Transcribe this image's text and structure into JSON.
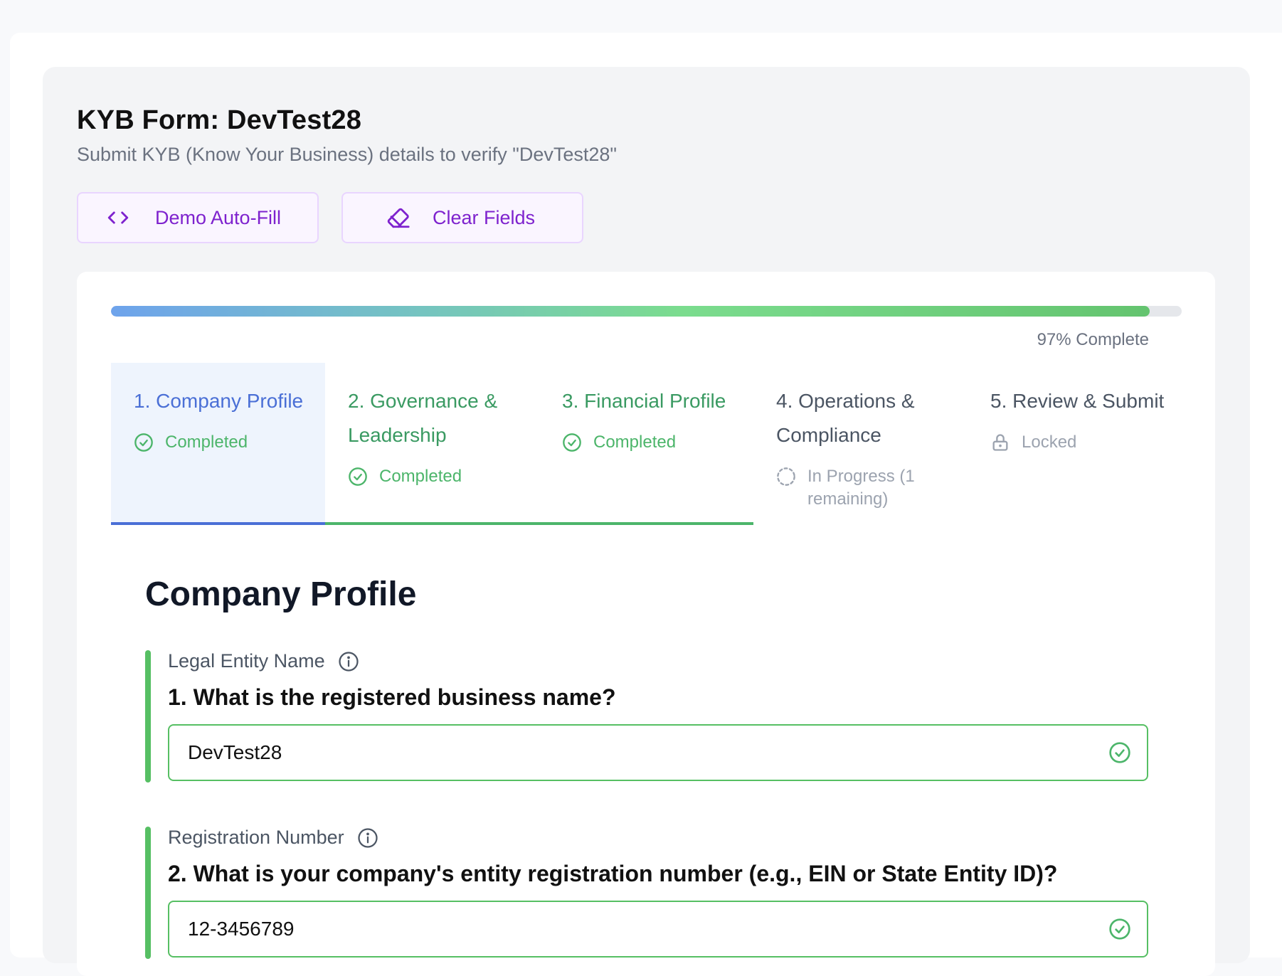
{
  "header": {
    "title": "KYB Form: DevTest28",
    "subtitle": "Submit KYB (Know Your Business) details to verify \"DevTest28\""
  },
  "actions": {
    "autofill_label": "Demo Auto-Fill",
    "autofill_icon": "code-icon",
    "clear_label": "Clear Fields",
    "clear_icon": "eraser-icon"
  },
  "progress": {
    "percent": 97,
    "label": "97% Complete"
  },
  "steps": [
    {
      "title": "1. Company Profile",
      "status": "Completed",
      "state": "active-completed"
    },
    {
      "title": "2. Governance & Leadership",
      "status": "Completed",
      "state": "completed"
    },
    {
      "title": "3. Financial Profile",
      "status": "Completed",
      "state": "completed"
    },
    {
      "title": "4. Operations & Compliance",
      "status": "In Progress (1 remaining)",
      "state": "in-progress"
    },
    {
      "title": "5. Review & Submit",
      "status": "Locked",
      "state": "locked"
    }
  ],
  "section": {
    "title": "Company Profile"
  },
  "questions": [
    {
      "label": "Legal Entity Name",
      "question": "1. What is the registered business name?",
      "value": "DevTest28"
    },
    {
      "label": "Registration Number",
      "question": "2. What is your company's entity registration number (e.g., EIN or State Entity ID)?",
      "value": "12-3456789"
    }
  ],
  "colors": {
    "accent_purple": "#7e22ce",
    "active_blue": "#4a6fd6",
    "completed_green": "#3a9a62",
    "field_border_green": "#56bf63"
  }
}
